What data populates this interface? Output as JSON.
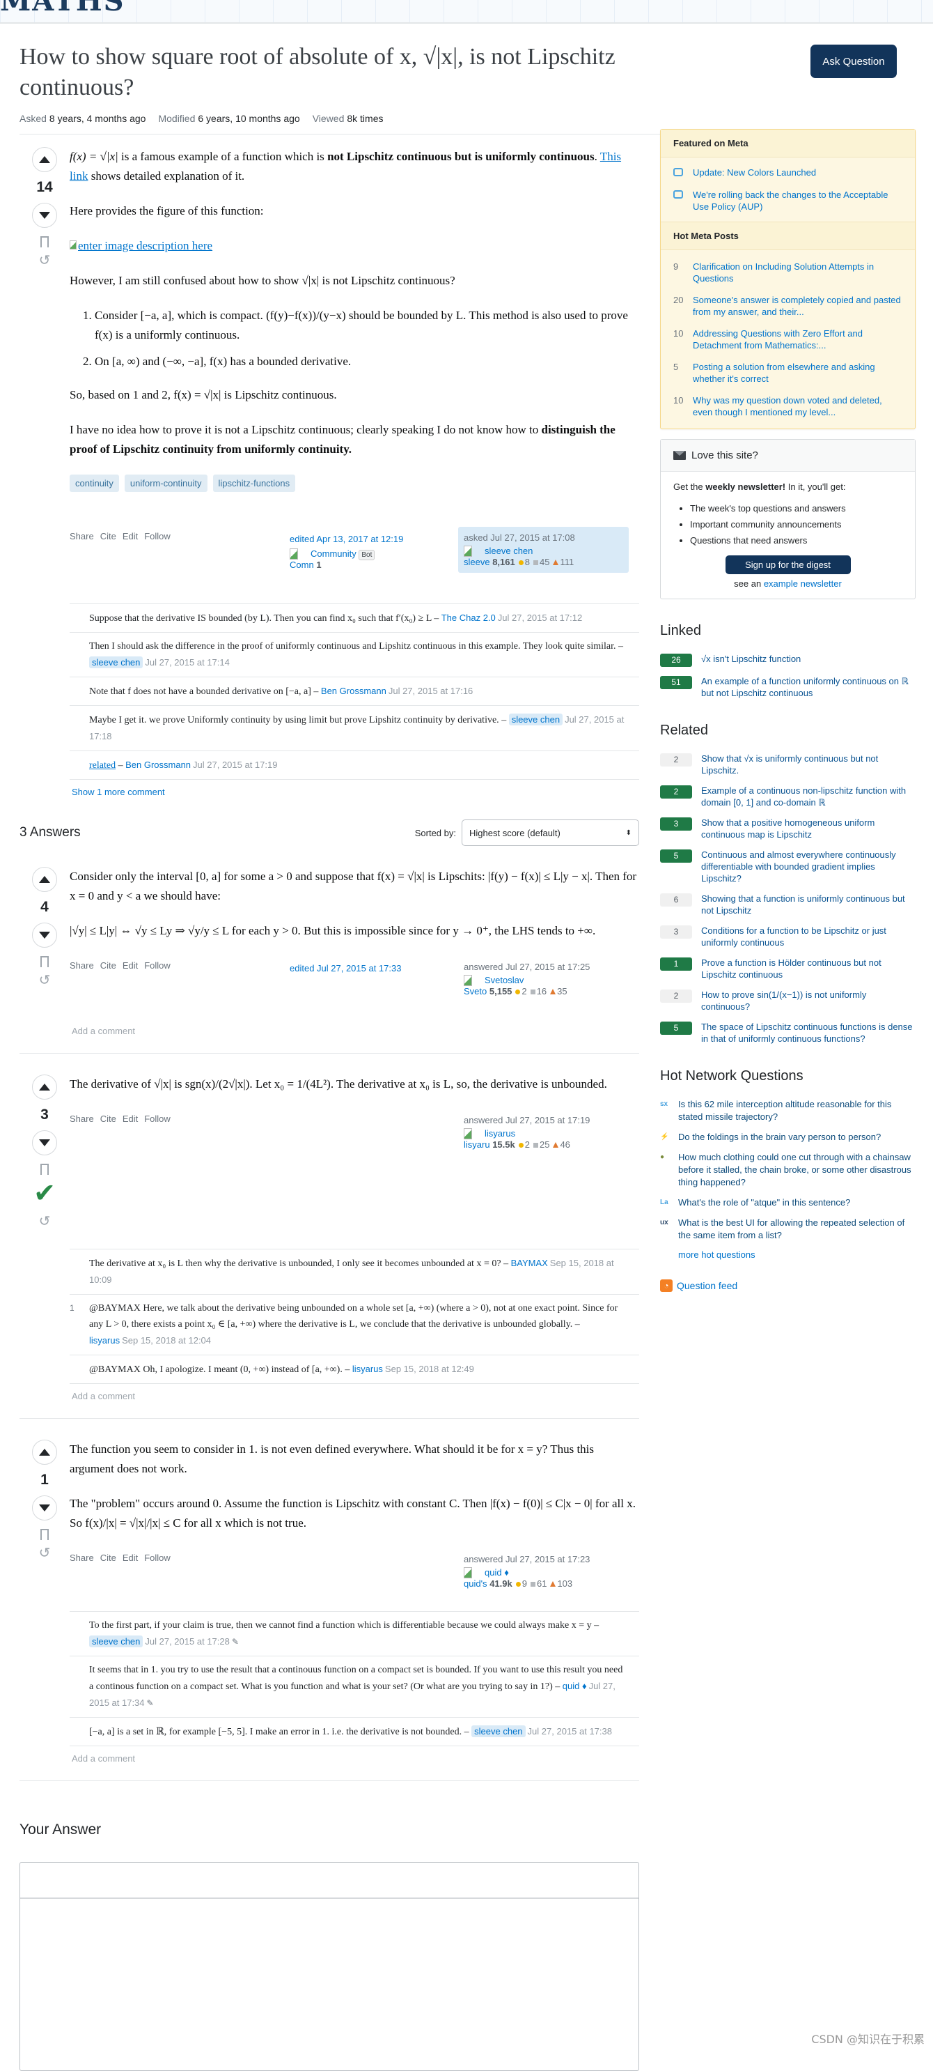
{
  "site": {
    "logo_text": "MATHS"
  },
  "question": {
    "title": "How to show square root of absolute of x, √|x|, is not Lipschitz continuous?",
    "ask_button": "Ask Question",
    "meta": [
      {
        "label": "Asked",
        "value": "8 years, 4 months ago"
      },
      {
        "label": "Modified",
        "value": "6 years, 10 months ago"
      },
      {
        "label": "Viewed",
        "value": "8k times"
      }
    ],
    "score": "14",
    "p1_a": "f(x) = √|x|",
    "p1_b": " is a famous example of a function which is ",
    "p1_bold": "not Lipschitz continuous but is uniformly continuous",
    "p1_c": ". ",
    "p1_link": "This link",
    "p1_d": " shows detailed explanation of it.",
    "p2": "Here provides the figure of this function:",
    "image_alt": "enter image description here",
    "p3": "However, I am still confused about how to show √|x| is not Lipschitz continuous?",
    "list": [
      "Consider [−a, a], which is compact. (f(y)−f(x))/(y−x) should be bounded by L. This method is also used to prove f(x) is a uniformly continuous.",
      "On [a, ∞) and (−∞, −a], f(x) has a bounded derivative."
    ],
    "p4": "So, based on 1 and 2, f(x) = √|x| is Lipschitz continuous.",
    "p5_a": "I have no idea how to prove it is not a Lipschitz continuous; clearly speaking I do not know how to ",
    "p5_bold": "distinguish the proof of Lipschitz continuity from uniformly continuity.",
    "tags": [
      "continuity",
      "uniform-continuity",
      "lipschitz-functions"
    ],
    "actions": [
      "Share",
      "Cite",
      "Edit",
      "Follow"
    ],
    "edited": {
      "text": "edited Apr 13, 2017 at 12:19",
      "user": "Community",
      "badge": "Bot",
      "avatar_alt": "Comn",
      "rep": "1"
    },
    "asked": {
      "text": "asked Jul 27, 2015 at 17:08",
      "user": "sleeve chen",
      "avatar_alt": "sleeve",
      "rep": "8,161",
      "gold": "8",
      "silver": "45",
      "bronze": "111"
    },
    "comments": [
      {
        "text": "Suppose that the derivative IS bounded (by L). Then you can find x₀ such that f′(x₀) ≥ L",
        "author": "The Chaz 2.0",
        "date": "Jul 27, 2015 at 17:12",
        "op": false
      },
      {
        "text": "Then I should ask the difference in the proof of uniformly continuous and Lipshitz continuous in this example. They look quite similar.",
        "author": "sleeve chen",
        "date": "Jul 27, 2015 at 17:14",
        "op": true
      },
      {
        "text": "Note that f does not have a bounded derivative on [−a, a]",
        "author": "Ben Grossmann",
        "date": "Jul 27, 2015 at 17:16",
        "op": false
      },
      {
        "text": "Maybe I get it. we prove Uniformly continuity by using limit but prove Lipshitz continuity by derivative.",
        "author": "sleeve chen",
        "date": "Jul 27, 2015 at 17:18",
        "op": true
      },
      {
        "text": "related",
        "author": "Ben Grossmann",
        "date": "Jul 27, 2015 at 17:19",
        "op": false
      }
    ],
    "show_more": "Show 1 more comment"
  },
  "answers_header": {
    "count": "3 Answers",
    "sorted_by": "Sorted by:",
    "sort_value": "Highest score (default)"
  },
  "answers": [
    {
      "score": "4",
      "accepted": false,
      "paragraphs": [
        "Consider only the interval [0, a] for some a > 0 and suppose that f(x) = √|x| is Lipschits: |f(y) − f(x)| ≤ L|y − x|. Then for x = 0 and y < a we should have:",
        "|√y| ≤ L|y| ⇔ √y ≤ Ly ⇒ √y/y ≤ L for each y > 0. But this is impossible since for y → 0⁺, the LHS tends to +∞."
      ],
      "edited": "edited Jul 27, 2015 at 17:33",
      "answered": "answered Jul 27, 2015 at 17:25",
      "user": "Svetoslav",
      "avatar_alt": "Sveto",
      "rep": "5,155",
      "gold": "2",
      "silver": "16",
      "bronze": "35",
      "comments": [],
      "add_comment": "Add a comment"
    },
    {
      "score": "3",
      "accepted": true,
      "paragraphs": [
        "The derivative of √|x| is sgn(x)/(2√|x|). Let x₀ = 1/(4L²). The derivative at x₀ is L, so, the derivative is unbounded."
      ],
      "edited": "",
      "answered": "answered Jul 27, 2015 at 17:19",
      "user": "lisyarus",
      "avatar_alt": "lisyaru",
      "rep": "15.5k",
      "gold": "2",
      "silver": "25",
      "bronze": "46",
      "comments": [
        {
          "score": "",
          "text": "The derivative at x₀ is L then why the derivative is unbounded, I only see it becomes unbounded at x = 0?",
          "author": "BAYMAX",
          "date": "Sep 15, 2018 at 10:09",
          "op": false
        },
        {
          "score": "1",
          "text": "@BAYMAX Here, we talk about the derivative being unbounded on a whole set [a, +∞) (where a > 0), not at one exact point. Since for any L > 0, there exists a point x₀ ∈ [a, +∞) where the derivative is L, we conclude that the derivative is unbounded globally.",
          "author": "lisyarus",
          "date": "Sep 15, 2018 at 12:04",
          "op": false
        },
        {
          "score": "",
          "text": "@BAYMAX Oh, I apologize. I meant (0, +∞) instead of [a, +∞).",
          "author": "lisyarus",
          "date": "Sep 15, 2018 at 12:49",
          "op": false
        }
      ],
      "add_comment": "Add a comment"
    },
    {
      "score": "1",
      "accepted": false,
      "paragraphs": [
        "The function you seem to consider in 1. is not even defined everywhere. What should it be for x = y? Thus this argument does not work.",
        "The \"problem\" occurs around 0. Assume the function is Lipschitz with constant C. Then |f(x) − f(0)| ≤ C|x − 0| for all x. So f(x)/|x| = √|x|/|x| ≤ C for all x which is not true."
      ],
      "edited": "",
      "answered": "answered Jul 27, 2015 at 17:23",
      "user": "quid ♦",
      "avatar_alt": "quid's",
      "rep": "41.9k",
      "gold": "9",
      "silver": "61",
      "bronze": "103",
      "comments": [
        {
          "score": "",
          "text": "To the first part, if your claim is true, then we cannot find a function which is differentiable because we could always make x = y",
          "author": "sleeve chen",
          "date": "Jul 27, 2015 at 17:28",
          "op": true,
          "edited": true
        },
        {
          "score": "",
          "text": "It seems that in 1. you try to use the result that a continouus function on a compact set is bounded. If you want to use this result you need a continous function on a compact set. What is you function and what is your set? (Or what are you trying to say in 1?)",
          "author": "quid ♦",
          "date": "Jul 27, 2015 at 17:34",
          "op": false,
          "edited": true
        },
        {
          "score": "",
          "text": "[−a, a] is a set in ℝ, for example [−5, 5]. I make an error in 1. i.e. the derivative is not bounded.",
          "author": "sleeve chen",
          "date": "Jul 27, 2015 at 17:38",
          "op": true
        }
      ],
      "add_comment": "Add a comment"
    }
  ],
  "your_answer": {
    "heading": "Your Answer"
  },
  "sidebar": {
    "featured_title": "Featured on Meta",
    "featured": [
      "Update: New Colors Launched",
      "We're rolling back the changes to the Acceptable Use Policy (AUP)"
    ],
    "hot_meta_title": "Hot Meta Posts",
    "hot_meta": [
      {
        "count": "9",
        "title": "Clarification on Including Solution Attempts in Questions"
      },
      {
        "count": "20",
        "title": "Someone's answer is completely copied and pasted from my answer, and their..."
      },
      {
        "count": "10",
        "title": "Addressing Questions with Zero Effort and Detachment from Mathematics:..."
      },
      {
        "count": "5",
        "title": "Posting a solution from elsewhere and asking whether it's correct"
      },
      {
        "count": "10",
        "title": "Why was my question down voted and deleted, even though I mentioned my level..."
      }
    ],
    "love": {
      "title": "Love this site?",
      "intro_a": "Get the ",
      "intro_bold": "weekly newsletter!",
      "intro_b": " In it, you'll get:",
      "items": [
        "The week's top questions and answers",
        "Important community announcements",
        "Questions that need answers"
      ],
      "button": "Sign up for the digest",
      "see_a": "see an ",
      "see_link": "example newsletter"
    },
    "linked_title": "Linked",
    "linked": [
      {
        "score": "26",
        "accepted": true,
        "title": "√x isn't Lipschitz function"
      },
      {
        "score": "51",
        "accepted": true,
        "title": "An example of a function uniformly continuous on ℝ but not Lipschitz continuous"
      }
    ],
    "related_title": "Related",
    "related": [
      {
        "score": "2",
        "accepted": false,
        "title": "Show that √x is uniformly continuous but not Lipschitz."
      },
      {
        "score": "2",
        "accepted": true,
        "title": "Example of a continuous non-lipschitz function with domain [0, 1] and co-domain ℝ"
      },
      {
        "score": "3",
        "accepted": true,
        "title": "Show that a positive homogeneous uniform continuous map is Lipschitz"
      },
      {
        "score": "5",
        "accepted": true,
        "title": "Continuous and almost everywhere continuously differentiable with bounded gradient implies Lipschitz?"
      },
      {
        "score": "6",
        "accepted": false,
        "title": "Showing that a function is uniformly continuous but not Lipschitz"
      },
      {
        "score": "3",
        "accepted": false,
        "title": "Conditions for a function to be Lipschitz or just uniformly continuous"
      },
      {
        "score": "1",
        "accepted": true,
        "title": "Prove a function is Hölder continuous but not Lipschitz continuous"
      },
      {
        "score": "2",
        "accepted": false,
        "title": "How to prove sin(1/(x−1)) is not uniformly continuous?"
      },
      {
        "score": "5",
        "accepted": true,
        "title": "The space of Lipschitz continuous functions is dense in that of uniformly continuous functions?"
      }
    ],
    "hot_network_title": "Hot Network Questions",
    "hot_network": [
      {
        "site_icon": "sx",
        "color": "#4aa3df",
        "title": "Is this 62 mile interception altitude reasonable for this stated missile trajectory?"
      },
      {
        "site_icon": "⚡",
        "color": "#e0405a",
        "title": "Do the foldings in the brain vary person to person?"
      },
      {
        "site_icon": "●",
        "color": "#7a8c3c",
        "title": "How much clothing could one cut through with a chainsaw before it stalled, the chain broke, or some other disastrous thing happened?"
      },
      {
        "site_icon": "La",
        "color": "#4aa3df",
        "title": "What's the role of \"atque\" in this sentence?"
      },
      {
        "site_icon": "ux",
        "color": "#2d4a6b",
        "title": "What is the best UI for allowing the repeated selection of the same item from a list?"
      }
    ],
    "more_hot": "more hot questions",
    "feed": "Question feed"
  },
  "watermark": "CSDN @知识在于积累"
}
